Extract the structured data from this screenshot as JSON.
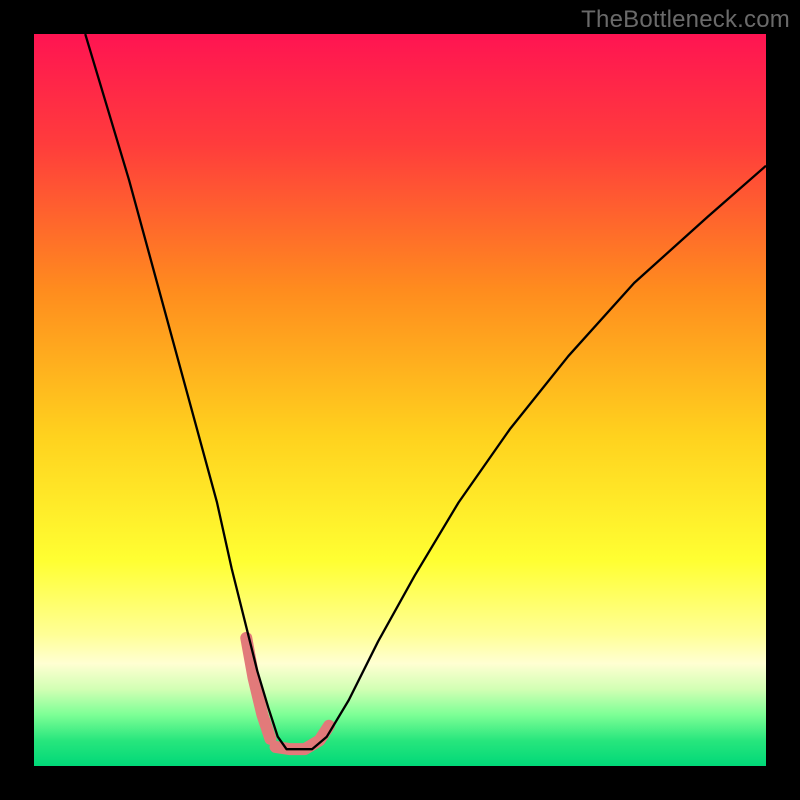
{
  "watermark": "TheBottleneck.com",
  "chart_data": {
    "type": "line",
    "title": "",
    "xlabel": "",
    "ylabel": "",
    "xlim": [
      0,
      100
    ],
    "ylim": [
      0,
      100
    ],
    "grid": false,
    "legend": false,
    "background_gradient_stops": [
      {
        "offset": 0.0,
        "color": "#ff1452"
      },
      {
        "offset": 0.15,
        "color": "#ff3c3c"
      },
      {
        "offset": 0.35,
        "color": "#ff8c1e"
      },
      {
        "offset": 0.55,
        "color": "#ffd21e"
      },
      {
        "offset": 0.72,
        "color": "#ffff32"
      },
      {
        "offset": 0.82,
        "color": "#ffff96"
      },
      {
        "offset": 0.86,
        "color": "#ffffd2"
      },
      {
        "offset": 0.895,
        "color": "#d2ffb4"
      },
      {
        "offset": 0.93,
        "color": "#7dff96"
      },
      {
        "offset": 0.965,
        "color": "#28e67d"
      },
      {
        "offset": 1.0,
        "color": "#00d878"
      }
    ],
    "series": [
      {
        "name": "bottleneck-curve",
        "stroke": "#000000",
        "stroke_width": 2.3,
        "x": [
          7,
          10,
          13,
          16,
          19,
          22,
          25,
          27,
          29,
          30.5,
          32,
          33.3,
          34.5,
          36,
          38,
          40,
          43,
          47,
          52,
          58,
          65,
          73,
          82,
          92,
          100
        ],
        "y": [
          100,
          90,
          80,
          69,
          58,
          47,
          36,
          27,
          19,
          13,
          8,
          4,
          2.3,
          2.3,
          2.3,
          4,
          9,
          17,
          26,
          36,
          46,
          56,
          66,
          75,
          82
        ]
      },
      {
        "name": "highlight-left",
        "stroke": "#e27a7a",
        "stroke_width": 12,
        "linecap": "round",
        "x": [
          29.0,
          30.0,
          31.2,
          32.3
        ],
        "y": [
          17.5,
          12.0,
          7.0,
          3.7
        ]
      },
      {
        "name": "highlight-bottom",
        "stroke": "#e27a7a",
        "stroke_width": 12,
        "linecap": "round",
        "x": [
          33.0,
          35.0,
          37.0,
          39.0,
          40.3
        ],
        "y": [
          2.6,
          2.3,
          2.3,
          3.5,
          5.5
        ]
      }
    ]
  }
}
